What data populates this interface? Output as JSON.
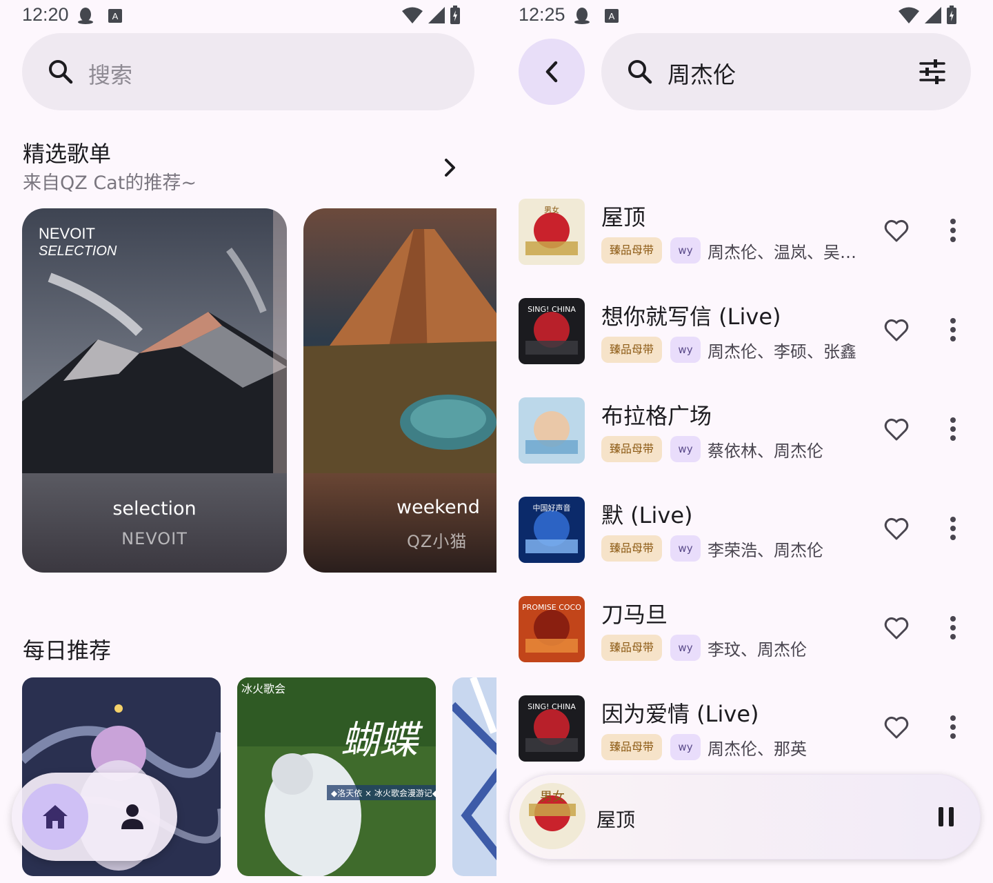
{
  "left_screen": {
    "status": {
      "time": "12:20"
    },
    "search": {
      "placeholder": "搜索"
    },
    "featured": {
      "title": "精选歌单",
      "subtitle": "来自QZ Cat的推荐~",
      "cards": [
        {
          "art_label_1": "NEVOIT",
          "art_label_2": "SELECTION",
          "title": "selection",
          "author": "NEVOIT"
        },
        {
          "title": "weekend",
          "author": "QZ小猫"
        }
      ]
    },
    "daily": {
      "title": "每日推荐",
      "covers": [
        {
          "icon": "vocaloid-art"
        },
        {
          "art_text": "冰火歌会",
          "art_text_2": "蝴蝶",
          "art_caption": "◆洛天依 × 冰火歌会漫游记◆"
        },
        {
          "icon": "anime-art"
        }
      ]
    },
    "nav": {
      "home_icon": "home-icon",
      "profile_icon": "person-icon"
    }
  },
  "right_screen": {
    "status": {
      "time": "12:25"
    },
    "search": {
      "query": "周杰伦"
    },
    "tag_quality": "臻品母带",
    "tag_source": "wy",
    "songs": [
      {
        "title": "屋顶",
        "artists": "周杰伦、温岚、吴…",
        "cover_text": "男女"
      },
      {
        "title": "想你就写信 (Live)",
        "artists": "周杰伦、李硕、张鑫",
        "cover_text": "SING! CHINA"
      },
      {
        "title": "布拉格广场",
        "artists": "蔡依林、周杰伦",
        "cover_text": ""
      },
      {
        "title": "默 (Live)",
        "artists": "李荣浩、周杰伦",
        "cover_text": "中国好声音"
      },
      {
        "title": "刀马旦",
        "artists": "李玟、周杰伦",
        "cover_text": "PROMISE COCO"
      },
      {
        "title": "因为爱情 (Live)",
        "artists": "周杰伦、那英",
        "cover_text": "SING! CHINA"
      }
    ],
    "player": {
      "title": "屋顶",
      "cover_text": "男女"
    }
  },
  "colors": {
    "background": "#fdf7fd",
    "search_bg": "#efe9f1",
    "accent": "#cfc0f5",
    "tag_quality_bg": "#f6e3c9",
    "tag_source_bg": "#e9ddfb"
  }
}
